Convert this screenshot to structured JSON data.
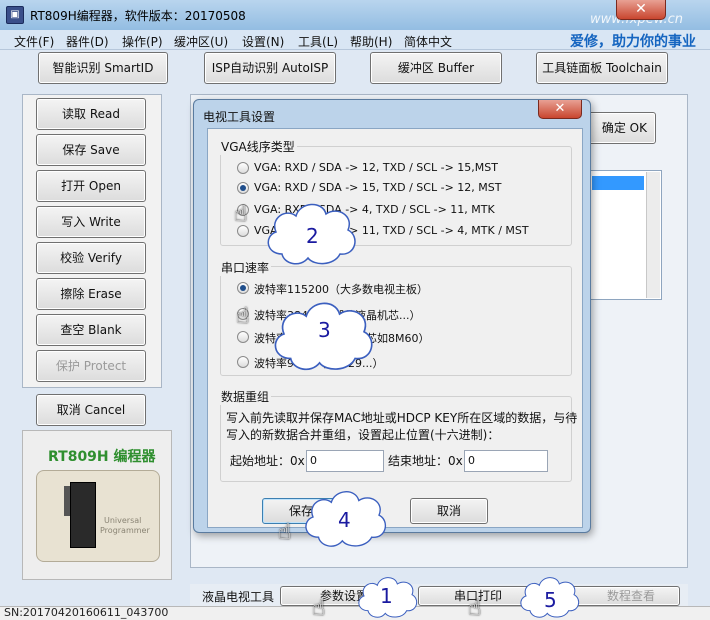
{
  "window": {
    "title": "RT809H编程器，软件版本：20170508",
    "watermark": "www.fxpew.cn",
    "close_label": "✕",
    "app_icon": "chip-icon"
  },
  "menu": {
    "items": [
      "文件(F)",
      "器件(D)",
      "操作(P)",
      "缓冲区(U)",
      "设置(N)",
      "工具(L)",
      "帮助(H)",
      "简体中文"
    ],
    "slogan": "爱修，助力你的事业"
  },
  "toolbar": {
    "smartid": "智能识别 SmartID",
    "autoisp": "ISP自动识别 AutoISP",
    "buffer": "缓冲区 Buffer",
    "toolchain": "工具链面板 Toolchain"
  },
  "left_buttons": {
    "read": "读取 Read",
    "save": "保存 Save",
    "open": "打开 Open",
    "write": "写入 Write",
    "verify": "校验 Verify",
    "erase": "擦除 Erase",
    "blank": "查空 Blank",
    "protect": "保护 Protect",
    "cancel": "取消 Cancel"
  },
  "product": {
    "title": "RT809H 编程器",
    "device_line1": "Universal",
    "device_line2": "Programmer"
  },
  "right_panel": {
    "ok_label": "确定 OK"
  },
  "bottom_bar": {
    "label": "液晶电视工具",
    "param_btn": "参数设置",
    "uart_btn": "串口打印",
    "view_btn": "数程查看"
  },
  "status": {
    "text": "SN:20170420160611_043700"
  },
  "dialog": {
    "title": "电视工具设置",
    "close_label": "✕",
    "vga_group": {
      "title": "VGA线序类型",
      "options": [
        {
          "label": "VGA: RXD / SDA -> 12, TXD / SCL -> 15,MST",
          "checked": false
        },
        {
          "label": "VGA: RXD / SDA -> 15, TXD / SCL -> 12, MST",
          "checked": true
        },
        {
          "label": "VGA: RXD / SDA ->  4, TXD / SCL -> 11, MTK",
          "checked": false
        },
        {
          "label": "VGA: RXD / SDA -> 11, TXD / SCL ->  4, MTK / MST",
          "checked": false
        }
      ]
    },
    "baud_group": {
      "title": "串口速率",
      "options": [
        {
          "label": "波特率115200（大多数电视主板）",
          "checked": true
        },
        {
          "label": "波特率38400（部分液晶机芯...）",
          "checked": false
        },
        {
          "label": "波特率57600（部分机芯如8M60）",
          "checked": false
        },
        {
          "label": "波特率9600（部分29...）",
          "checked": false
        }
      ]
    },
    "merge_group": {
      "title": "数据重组",
      "description_line1": "写入前先读取并保存MAC地址或HDCP KEY所在区域的数据，与待",
      "description_line2": "写入的新数据合并重组，设置起止位置(十六进制)：",
      "start_label": "起始地址：0x",
      "start_value": "0",
      "end_label": "结束地址：0x",
      "end_value": "0"
    },
    "save_btn": "保存",
    "cancel_btn": "取消"
  },
  "callouts": [
    "1",
    "2",
    "3",
    "4",
    "5"
  ]
}
